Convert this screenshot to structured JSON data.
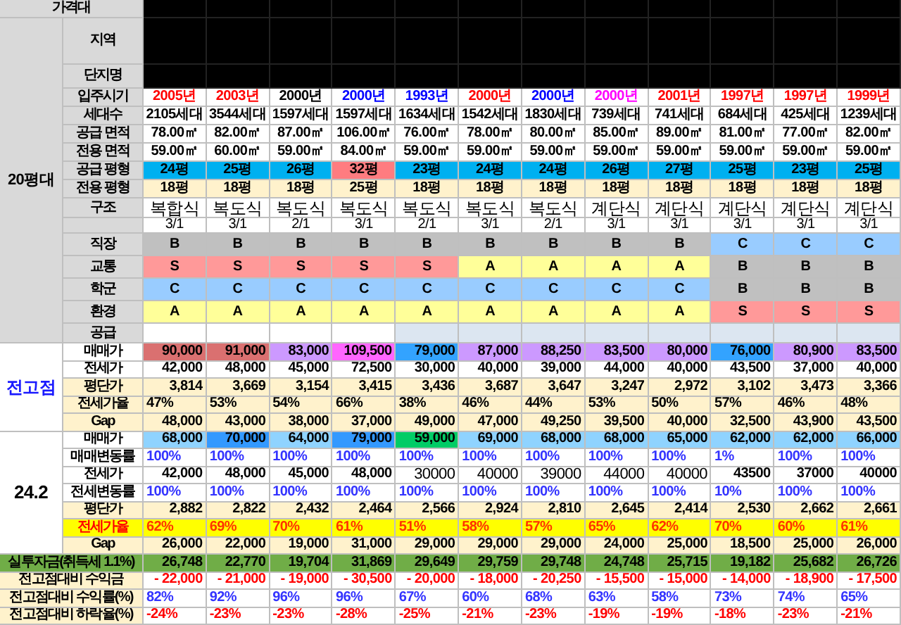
{
  "top_rows": [
    {
      "label": "가격대",
      "kind": "masked_header"
    }
  ],
  "sections": [
    {
      "title": "20평대",
      "kind": "size",
      "rows": [
        {
          "label": "지역",
          "kind": "masked_tall"
        },
        {
          "label": "단지명",
          "kind": "masked"
        },
        {
          "label": "입주시기",
          "kind": "year",
          "cells": [
            {
              "text": "2005년",
              "color": "#ff0000"
            },
            {
              "text": "2003년",
              "color": "#ff0000"
            },
            {
              "text": "2000년",
              "color": "#000000"
            },
            {
              "text": "2000년",
              "color": "#0000ff"
            },
            {
              "text": "1993년",
              "color": "#0000ff"
            },
            {
              "text": "2000년",
              "color": "#ff0000"
            },
            {
              "text": "2000년",
              "color": "#0000ff"
            },
            {
              "text": "2000년",
              "color": "#ff00ff"
            },
            {
              "text": "2001년",
              "color": "#ff0000"
            },
            {
              "text": "1997년",
              "color": "#ff0000"
            },
            {
              "text": "1997년",
              "color": "#ff0000"
            },
            {
              "text": "1999년",
              "color": "#ff0000"
            }
          ]
        },
        {
          "label": "세대수",
          "kind": "info",
          "cells": [
            "2105세대",
            "3544세대",
            "1597세대",
            "1597세대",
            "1634세대",
            "1542세대",
            "1830세대",
            "739세대",
            "741세대",
            "684세대",
            "425세대",
            "1239세대"
          ]
        },
        {
          "label": "공급 면적",
          "kind": "info",
          "cells": [
            "78.00㎡",
            "82.00㎡",
            "87.00㎡",
            "106.00㎡",
            "76.00㎡",
            "78.00㎡",
            "80.00㎡",
            "85.00㎡",
            "89.00㎡",
            "81.00㎡",
            "77.00㎡",
            "82.00㎡"
          ]
        },
        {
          "label": "전용 면적",
          "kind": "info",
          "cells": [
            "59.00㎡",
            "60.00㎡",
            "59.00㎡",
            "84.00㎡",
            "59.00㎡",
            "59.00㎡",
            "59.00㎡",
            "59.00㎡",
            "59.00㎡",
            "59.00㎡",
            "59.00㎡",
            "59.00㎡"
          ]
        },
        {
          "label": "공급 평형",
          "kind": "info",
          "cells": [
            {
              "text": "24평",
              "color": "#00b0f0"
            },
            {
              "text": "25평",
              "color": "#00b0f0"
            },
            {
              "text": "26평",
              "color": "#00b0f0"
            },
            {
              "text": "32평",
              "color": "#ff7c80"
            },
            {
              "text": "23평",
              "color": "#00b0f0"
            },
            {
              "text": "24평",
              "color": "#00b0f0"
            },
            {
              "text": "24평",
              "color": "#00b0f0"
            },
            {
              "text": "26평",
              "color": "#00b0f0"
            },
            {
              "text": "27평",
              "color": "#00b0f0"
            },
            {
              "text": "25평",
              "color": "#00b0f0"
            },
            {
              "text": "23평",
              "color": "#00b0f0"
            },
            {
              "text": "25평",
              "color": "#00b0f0"
            }
          ]
        },
        {
          "label": "전용 평형",
          "kind": "band_info",
          "cells": [
            "18평",
            "18평",
            "18평",
            "25평",
            "18평",
            "18평",
            "18평",
            "18평",
            "18평",
            "18평",
            "18평",
            "18평"
          ]
        },
        {
          "label": "구조",
          "kind": "structure",
          "cells": [
            "복합식",
            "복도식",
            "복도식",
            "복도식",
            "복도식",
            "복도식",
            "복도식",
            "계단식",
            "계단식",
            "계단식",
            "계단식",
            "계단식"
          ]
        },
        {
          "kind": "ratio",
          "cells": [
            "3/1",
            "3/1",
            "2/1",
            "3/1",
            "2/1",
            "3/1",
            "2/1",
            "3/1",
            "3/1",
            "3/1",
            "3/1",
            "3/1"
          ]
        },
        {
          "label": "직장",
          "kind": "grade",
          "cells": [
            {
              "text": "B",
              "color": "#c0c0c0"
            },
            {
              "text": "B",
              "color": "#c0c0c0"
            },
            {
              "text": "B",
              "color": "#c0c0c0"
            },
            {
              "text": "B",
              "color": "#c0c0c0"
            },
            {
              "text": "B",
              "color": "#c0c0c0"
            },
            {
              "text": "B",
              "color": "#c0c0c0"
            },
            {
              "text": "B",
              "color": "#c0c0c0"
            },
            {
              "text": "B",
              "color": "#c0c0c0"
            },
            {
              "text": "B",
              "color": "#c0c0c0"
            },
            {
              "text": "C",
              "color": "#99ccff"
            },
            {
              "text": "C",
              "color": "#99ccff"
            },
            {
              "text": "C",
              "color": "#99ccff"
            }
          ]
        },
        {
          "label": "교통",
          "kind": "grade",
          "cells": [
            {
              "text": "S",
              "color": "#ff9999"
            },
            {
              "text": "S",
              "color": "#ff9999"
            },
            {
              "text": "S",
              "color": "#ff9999"
            },
            {
              "text": "S",
              "color": "#ff9999"
            },
            {
              "text": "S",
              "color": "#ff9999"
            },
            {
              "text": "A",
              "color": "#ffff99"
            },
            {
              "text": "A",
              "color": "#ffff99"
            },
            {
              "text": "A",
              "color": "#ffff99"
            },
            {
              "text": "A",
              "color": "#ffff99"
            },
            {
              "text": "B",
              "color": "#c0c0c0"
            },
            {
              "text": "B",
              "color": "#c0c0c0"
            },
            {
              "text": "B",
              "color": "#c0c0c0"
            }
          ]
        },
        {
          "label": "학군",
          "kind": "grade",
          "cells": [
            {
              "text": "C",
              "color": "#99ccff"
            },
            {
              "text": "C",
              "color": "#99ccff"
            },
            {
              "text": "C",
              "color": "#99ccff"
            },
            {
              "text": "C",
              "color": "#99ccff"
            },
            {
              "text": "C",
              "color": "#99ccff"
            },
            {
              "text": "C",
              "color": "#99ccff"
            },
            {
              "text": "C",
              "color": "#99ccff"
            },
            {
              "text": "C",
              "color": "#99ccff"
            },
            {
              "text": "C",
              "color": "#99ccff"
            },
            {
              "text": "B",
              "color": "#c0c0c0"
            },
            {
              "text": "B",
              "color": "#c0c0c0"
            },
            {
              "text": "B",
              "color": "#c0c0c0"
            }
          ]
        },
        {
          "label": "환경",
          "kind": "grade",
          "cells": [
            {
              "text": "A",
              "color": "#ffff99"
            },
            {
              "text": "A",
              "color": "#ffff99"
            },
            {
              "text": "A",
              "color": "#ffff99"
            },
            {
              "text": "A",
              "color": "#ffff99"
            },
            {
              "text": "A",
              "color": "#ffff99"
            },
            {
              "text": "A",
              "color": "#ffff99"
            },
            {
              "text": "A",
              "color": "#ffff99"
            },
            {
              "text": "A",
              "color": "#ffff99"
            },
            {
              "text": "A",
              "color": "#ffff99"
            },
            {
              "text": "S",
              "color": "#ff9999"
            },
            {
              "text": "S",
              "color": "#ff9999"
            },
            {
              "text": "S",
              "color": "#ff9999"
            }
          ]
        },
        {
          "label": "공급",
          "kind": "supply",
          "cells": [
            {
              "color": "#ffffff"
            },
            {
              "color": "#ffffff"
            },
            {
              "color": "#ffffff"
            },
            {
              "color": "#ffffff"
            },
            {
              "color": "#dce6f1"
            },
            {
              "color": "#dce6f1"
            },
            {
              "color": "#dce6f1"
            },
            {
              "color": "#dce6f1"
            },
            {
              "color": "#dce6f1"
            },
            {
              "color": "#dce6f1"
            },
            {
              "color": "#dce6f1"
            },
            {
              "color": "#dce6f1"
            }
          ]
        }
      ]
    },
    {
      "title": "전고점",
      "kind": "peak",
      "rows": [
        {
          "label": "매매가",
          "kind": "price",
          "cells": [
            {
              "text": "90,000",
              "color": "#da7070"
            },
            {
              "text": "91,000",
              "color": "#da7070"
            },
            {
              "text": "83,000",
              "color": "#cc99ff"
            },
            {
              "text": "109,500",
              "color": "#ff66ff"
            },
            {
              "text": "79,000",
              "color": "#33a3ff"
            },
            {
              "text": "87,000",
              "color": "#cc99ff"
            },
            {
              "text": "88,250",
              "color": "#cc99ff"
            },
            {
              "text": "83,500",
              "color": "#cc99ff"
            },
            {
              "text": "80,000",
              "color": "#cc99ff"
            },
            {
              "text": "76,000",
              "color": "#33a3ff"
            },
            {
              "text": "80,900",
              "color": "#cc99ff"
            },
            {
              "text": "83,500",
              "color": "#cc99ff"
            }
          ]
        },
        {
          "label": "전세가",
          "kind": "price",
          "cells": [
            "42,000",
            "48,000",
            "45,000",
            "72,500",
            "30,000",
            "40,000",
            "39,000",
            "44,000",
            "40,000",
            "43,500",
            "37,000",
            "40,000"
          ]
        },
        {
          "label": "평단가",
          "kind": "band_number",
          "cells": [
            "3,814",
            "3,669",
            "3,154",
            "3,415",
            "3,436",
            "3,687",
            "3,647",
            "3,247",
            "2,972",
            "3,102",
            "3,473",
            "3,366"
          ]
        },
        {
          "label": "전세가율",
          "kind": "band_percent",
          "cells": [
            "47%",
            "53%",
            "54%",
            "66%",
            "38%",
            "46%",
            "44%",
            "53%",
            "50%",
            "57%",
            "46%",
            "48%"
          ]
        },
        {
          "label": "Gap",
          "kind": "band_number",
          "cells": [
            "48,000",
            "43,000",
            "38,000",
            "37,000",
            "49,000",
            "47,000",
            "49,250",
            "39,500",
            "40,000",
            "32,500",
            "43,900",
            "43,500"
          ]
        }
      ]
    },
    {
      "title": "24.2",
      "kind": "current",
      "rows": [
        {
          "label": "매매가",
          "kind": "price",
          "cells": [
            {
              "text": "68,000",
              "color": "#8fd3ff"
            },
            {
              "text": "70,000",
              "color": "#3399ff"
            },
            {
              "text": "64,000",
              "color": "#8fd3ff"
            },
            {
              "text": "79,000",
              "color": "#3399ff"
            },
            {
              "text": "59,000",
              "color": "#00cc66"
            },
            {
              "text": "69,000",
              "color": "#8fd3ff"
            },
            {
              "text": "68,000",
              "color": "#8fd3ff"
            },
            {
              "text": "68,000",
              "color": "#8fd3ff"
            },
            {
              "text": "65,000",
              "color": "#8fd3ff"
            },
            {
              "text": "62,000",
              "color": "#8fd3ff"
            },
            {
              "text": "62,000",
              "color": "#8fd3ff"
            },
            {
              "text": "66,000",
              "color": "#8fd3ff"
            }
          ]
        },
        {
          "label": "매매변동률",
          "kind": "rate",
          "cells": [
            "100%",
            "100%",
            "100%",
            "100%",
            "100%",
            "100%",
            "100%",
            "100%",
            "100%",
            "1%",
            "100%",
            "100%"
          ]
        },
        {
          "label": "전세가",
          "kind": "price",
          "cells": [
            {
              "text": "42,000",
              "bold": true
            },
            {
              "text": "48,000",
              "bold": true
            },
            {
              "text": "45,000",
              "bold": true
            },
            {
              "text": "48,000",
              "bold": true
            },
            {
              "text": "30000",
              "bold": false
            },
            {
              "text": "40000",
              "bold": false
            },
            {
              "text": "39000",
              "bold": false
            },
            {
              "text": "44000",
              "bold": false
            },
            {
              "text": "40000",
              "bold": false
            },
            {
              "text": "43500",
              "bold": true
            },
            {
              "text": "37000",
              "bold": true
            },
            {
              "text": "40000",
              "bold": true
            }
          ]
        },
        {
          "label": "전세변동률",
          "kind": "rate",
          "cells": [
            "100%",
            "100%",
            "100%",
            "100%",
            "100%",
            "100%",
            "100%",
            "100%",
            "100%",
            "10%",
            "100%",
            "100%"
          ]
        },
        {
          "label": "평단가",
          "kind": "band_number",
          "cells": [
            "2,882",
            "2,822",
            "2,432",
            "2,464",
            "2,566",
            "2,924",
            "2,810",
            "2,645",
            "2,414",
            "2,530",
            "2,662",
            "2,661"
          ]
        },
        {
          "label": "전세가율",
          "kind": "alert",
          "cells": [
            "62%",
            "69%",
            "70%",
            "61%",
            "51%",
            "58%",
            "57%",
            "65%",
            "62%",
            "70%",
            "60%",
            "61%"
          ]
        },
        {
          "label": "Gap",
          "kind": "band_number",
          "cells": [
            "26,000",
            "22,000",
            "19,000",
            "31,000",
            "29,000",
            "29,000",
            "29,000",
            "24,000",
            "25,000",
            "18,500",
            "25,000",
            "26,000"
          ]
        }
      ]
    }
  ],
  "bottom_rows": [
    {
      "label": "실투자금(취득세 1.1%)",
      "kind": "invest",
      "cells": [
        "26,748",
        "22,770",
        "19,704",
        "31,869",
        "29,649",
        "29,759",
        "29,748",
        "24,748",
        "25,715",
        "19,182",
        "25,682",
        "26,726"
      ]
    },
    {
      "label": "전고점대비 수익금",
      "kind": "loss",
      "cells": [
        "- 22,000",
        "- 21,000",
        "- 19,000",
        "- 30,500",
        "- 20,000",
        "- 18,000",
        "- 20,250",
        "- 15,500",
        "- 15,000",
        "- 14,000",
        "- 18,900",
        "- 17,500"
      ]
    },
    {
      "label": "전고점대비 수익률(%)",
      "kind": "gain_rate",
      "cells": [
        "82%",
        "92%",
        "96%",
        "96%",
        "67%",
        "60%",
        "68%",
        "63%",
        "58%",
        "73%",
        "74%",
        "65%"
      ]
    },
    {
      "label": "전고점대비 하락율(%)",
      "kind": "loss_rate",
      "cells": [
        "-24%",
        "-23%",
        "-23%",
        "-28%",
        "-25%",
        "-21%",
        "-23%",
        "-19%",
        "-19%",
        "-18%",
        "-23%",
        "-21%"
      ]
    }
  ]
}
